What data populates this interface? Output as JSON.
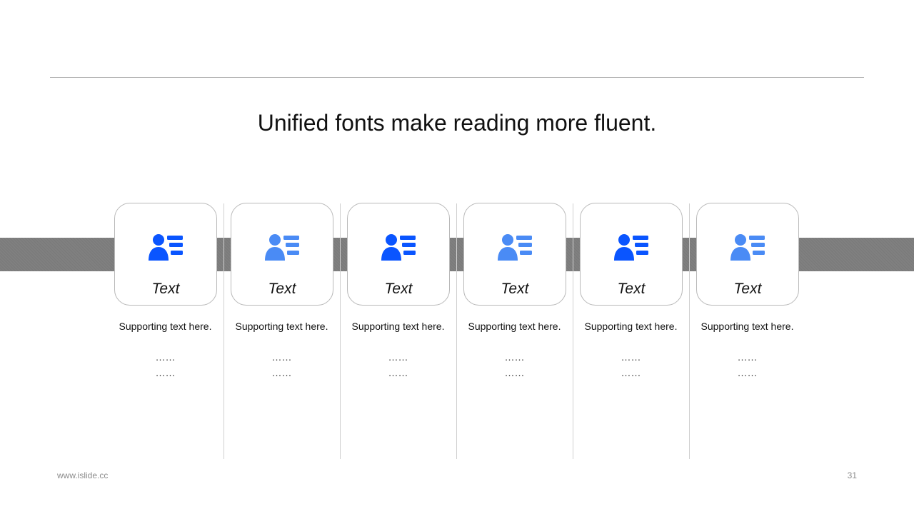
{
  "slide": {
    "title": "Unified fonts make reading more fluent.",
    "colors": {
      "accent_dark": "#0a55ff",
      "accent_light": "#4a8bf5",
      "band": "#808080",
      "border": "#b9b9b9"
    },
    "items": [
      {
        "label": "Text",
        "supporting": "Supporting text here.",
        "line1": "……",
        "line2": "……",
        "icon": "user-list-icon",
        "color": "#0a55ff"
      },
      {
        "label": "Text",
        "supporting": "Supporting text here.",
        "line1": "……",
        "line2": "……",
        "icon": "user-list-icon",
        "color": "#4a8bf5"
      },
      {
        "label": "Text",
        "supporting": "Supporting text here.",
        "line1": "……",
        "line2": "……",
        "icon": "user-list-icon",
        "color": "#0a55ff"
      },
      {
        "label": "Text",
        "supporting": "Supporting text here.",
        "line1": "……",
        "line2": "……",
        "icon": "user-list-icon",
        "color": "#4a8bf5"
      },
      {
        "label": "Text",
        "supporting": "Supporting text here.",
        "line1": "……",
        "line2": "……",
        "icon": "user-list-icon",
        "color": "#0a55ff"
      },
      {
        "label": "Text",
        "supporting": "Supporting text here.",
        "line1": "……",
        "line2": "……",
        "icon": "user-list-icon",
        "color": "#4a8bf5"
      }
    ],
    "footer": {
      "url": "www.islide.cc",
      "page": "31"
    }
  }
}
